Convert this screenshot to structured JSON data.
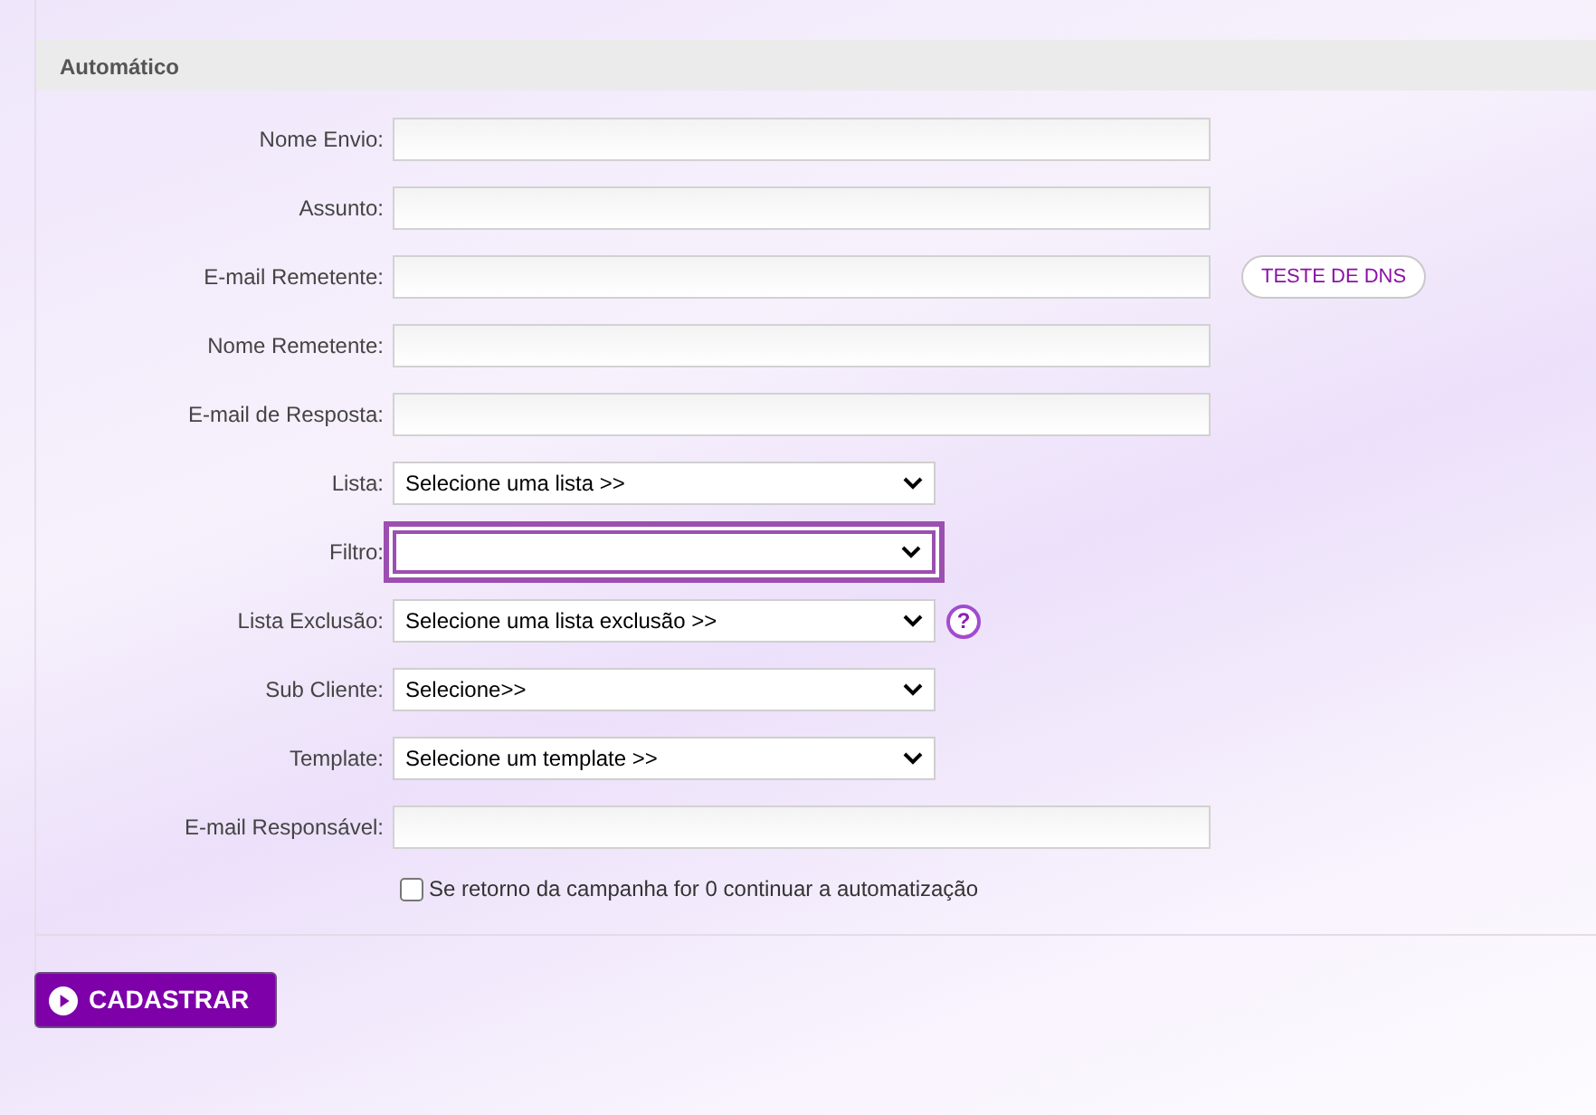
{
  "section": {
    "title": "Automático"
  },
  "fields": [
    {
      "label": "Nome Envio:",
      "kind": "text"
    },
    {
      "label": "Assunto:",
      "kind": "text"
    },
    {
      "label": "E-mail Remetente:",
      "kind": "text",
      "action": "TESTE DE DNS"
    },
    {
      "label": "Nome Remetente:",
      "kind": "text"
    },
    {
      "label": "E-mail de Resposta:",
      "kind": "text"
    },
    {
      "label": "Lista:",
      "kind": "select",
      "value": "Selecione uma lista >>",
      "focused": false
    },
    {
      "label": "Filtro:",
      "kind": "select",
      "focused": true
    },
    {
      "label": "Lista Exclusão:",
      "kind": "select",
      "value": "Selecione uma lista exclusão >>",
      "focused": false,
      "help": "?"
    },
    {
      "label": "Sub Cliente:",
      "kind": "select",
      "value": "Selecione>>",
      "focused": false
    },
    {
      "label": "Template:",
      "kind": "select",
      "value": "Selecione um template >>",
      "focused": false
    },
    {
      "label": "E-mail Responsável:",
      "kind": "text"
    }
  ],
  "option": {
    "label": "Se retorno da campanha for 0 continuar a automatização",
    "checked": false
  },
  "submit": {
    "label": "CADASTRAR"
  }
}
